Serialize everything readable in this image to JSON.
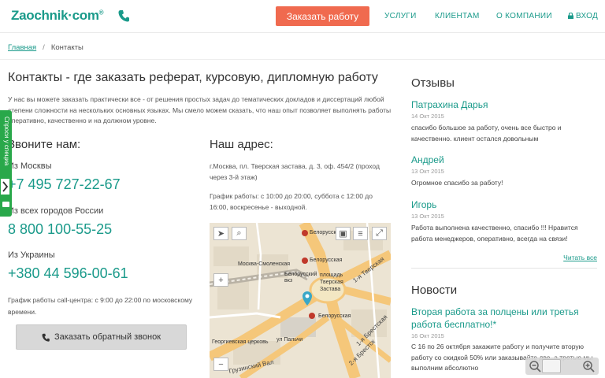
{
  "header": {
    "logo": "Zaochnik",
    "logo_suffix": "com",
    "logo_reg": "®",
    "cta": "Заказать работу",
    "nav": [
      "УСЛУГИ",
      "КЛИЕНТАМ",
      "О КОМПАНИИ"
    ],
    "login": "ВХОД"
  },
  "breadcrumb": {
    "home": "Главная",
    "separator": "/",
    "current": "Контакты"
  },
  "main": {
    "title": "Контакты - где заказать реферат, курсовую, дипломную работу",
    "intro": "У нас вы можете заказать практически все - от решения простых задач до тематических докладов и диссертаций любой степени сложности на нескольких основных языках. Мы смело можем сказать, что наш опыт позволяет выполнять работы оперативно, качественно и на должном уровне.",
    "call_heading": "Звоните нам:",
    "phones": [
      {
        "label": "Из Москвы",
        "number": "+7 495 727-22-67"
      },
      {
        "label": "Из всех городов России",
        "number": "8 800 100-55-25"
      },
      {
        "label": "Из Украины",
        "number": "+380 44 596-00-61"
      }
    ],
    "hours": "График работы call-центра: с 9:00 до 22:00 по московскому времени.",
    "callback_button": "Заказать обратный звонок",
    "address_heading": "Наш адрес:",
    "address": "г.Москва, пл. Тверская застава, д. 3, оф. 454/2 (проход через 3-й этаж)",
    "schedule": "График работы: с 10:00 до 20:00, суббота с 12:00 до 16:00, воскресенье - выходной."
  },
  "map": {
    "labels": [
      "Белорусская",
      "Белорусская",
      "Москва-Смоленская",
      "площадь Тверская Застава",
      "1-я Тверская",
      "Белорусский вкз",
      "Георгиевская церковь",
      "Белорусская",
      "ул Пальчи",
      "Грузинский Вал",
      "2-я Брестск",
      "1-я Брестская"
    ],
    "zoom_in": "+",
    "zoom_out": "−"
  },
  "side_tab": {
    "label": "Спроси у специа"
  },
  "reviews": {
    "title": "Отзывы",
    "items": [
      {
        "name": "Патрахина Дарья",
        "date": "14 Окт 2015",
        "text": "спасибо большое за работу, очень все быстро и качественно. клиент остался довольным"
      },
      {
        "name": "Андрей",
        "date": "13 Окт 2015",
        "text": "Огромное спасибо за работу!"
      },
      {
        "name": "Игорь",
        "date": "13 Окт 2015",
        "text": "Работа выполнена качественно, спасибо !!! Нравится работа менеджеров, оперативно, всегда на связи!"
      }
    ],
    "read_all": "Читать все"
  },
  "news": {
    "title": "Новости",
    "headline": "Вторая работа за полцены или третья работа бесплатно!*",
    "date": "16 Окт 2015",
    "text": "С 16 по 26 октября закажите работу и получите вторую работу со скидкой 50% или заказывайте две, а третью мы выполним абсолютно"
  },
  "colors": {
    "accent": "#1a9a8a",
    "cta": "#f06a4f",
    "side_tab": "#29a84a"
  }
}
